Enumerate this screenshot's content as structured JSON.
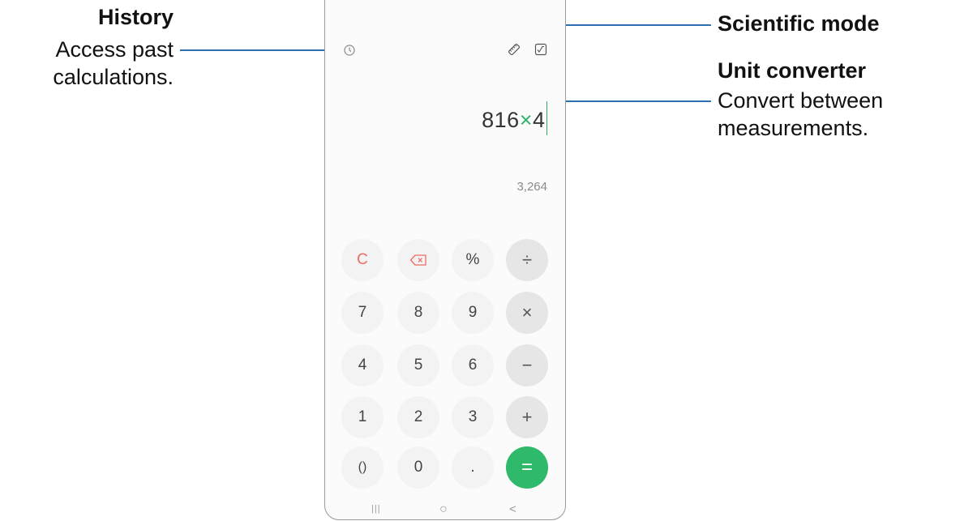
{
  "callouts": {
    "history": {
      "title": "History",
      "desc_line1": "Access past",
      "desc_line2": "calculations."
    },
    "scientific": {
      "title": "Scientific mode"
    },
    "unit": {
      "title": "Unit converter",
      "desc_line1": "Convert between",
      "desc_line2": "measurements."
    }
  },
  "calculator": {
    "icons": {
      "history": "history-icon",
      "ruler": "ruler-icon",
      "scientific": "scientific-mode-icon"
    },
    "expression": {
      "left": "816",
      "operator": "×",
      "right": "4"
    },
    "result": "3,264",
    "keys": {
      "row1": [
        "C",
        "⌫",
        "%",
        "÷"
      ],
      "row2": [
        "7",
        "8",
        "9",
        "×"
      ],
      "row3": [
        "4",
        "5",
        "6",
        "−"
      ],
      "row4": [
        "1",
        "2",
        "3",
        "+"
      ],
      "row5": [
        "()",
        "0",
        ".",
        "="
      ]
    },
    "nav": {
      "recent": "|||",
      "home": "○",
      "back": "<"
    }
  },
  "colors": {
    "accent": "#2fb96b",
    "clear": "#ee6c62",
    "leader": "#2e6fb3"
  }
}
